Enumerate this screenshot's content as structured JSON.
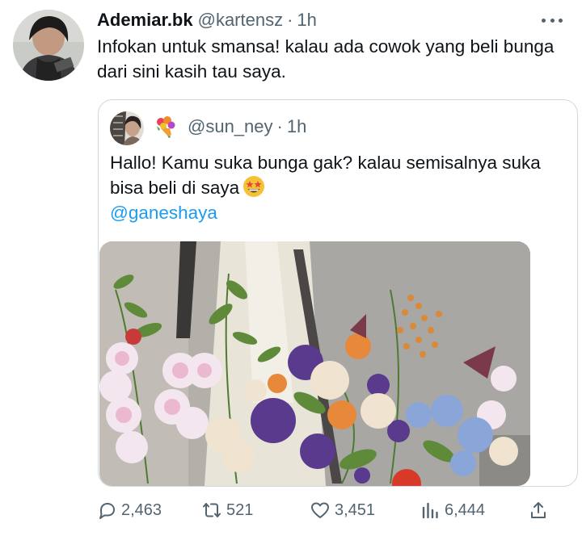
{
  "tweet": {
    "display_name": "Ademiar.bk",
    "handle": "@kartensz",
    "dot": "·",
    "time": "1h",
    "text": "Infokan untuk smansa! kalau ada cowok yang beli bunga dari sini kasih tau saya."
  },
  "quote": {
    "handle": "@sun_ney",
    "dot": "·",
    "time": "1h",
    "text": "Hallo! Kamu suka bunga gak? kalau semisalnya suka bisa beli di saya",
    "mention": "@ganeshaya"
  },
  "actions": {
    "replies": "2,463",
    "retweets": "521",
    "likes": "3,451",
    "views": "6,444"
  },
  "icons": {
    "avatar": "avatar",
    "more": "more-icon",
    "reply": "reply-icon",
    "retweet": "retweet-icon",
    "like": "heart-icon",
    "views": "views-icon",
    "share": "share-icon",
    "bouquet": "bouquet-emoji",
    "star_struck": "star-struck-emoji"
  },
  "colors": {
    "link": "#1d9bf0",
    "secondary_text": "#536471",
    "primary_text": "#0f1419",
    "border": "#cfd9de"
  }
}
